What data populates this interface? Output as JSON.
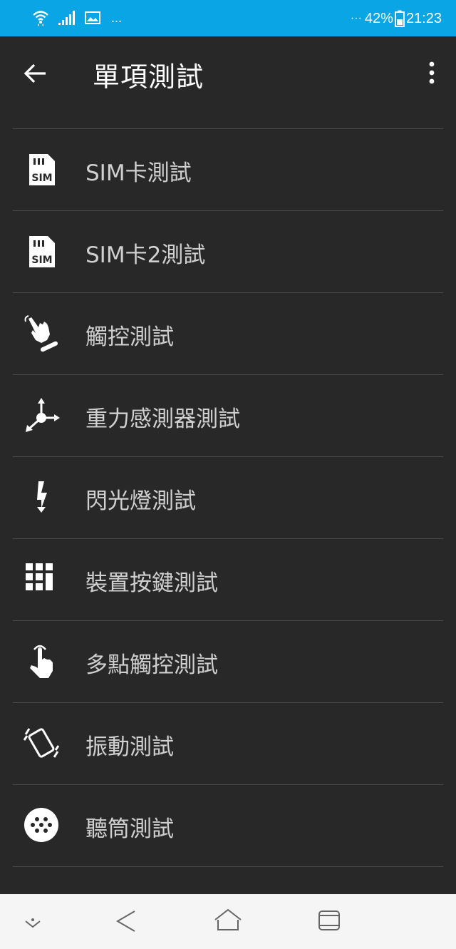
{
  "status_bar": {
    "battery_percent": "42%",
    "time": "21:23",
    "more_dots": "...",
    "notif_dots": "···",
    "icons": [
      "wifi-icon",
      "signal-icon",
      "image-icon",
      "battery-icon"
    ]
  },
  "app_bar": {
    "title": "單項測試",
    "icons": [
      "back-arrow-icon",
      "overflow-menu-icon"
    ]
  },
  "items": [
    {
      "label": "SIM卡測試",
      "icon": "sim-card-icon"
    },
    {
      "label": "SIM卡2測試",
      "icon": "sim-card-icon"
    },
    {
      "label": "觸控測試",
      "icon": "touch-hand-icon"
    },
    {
      "label": "重力感測器測試",
      "icon": "axis-icon"
    },
    {
      "label": "閃光燈測試",
      "icon": "flash-icon"
    },
    {
      "label": "裝置按鍵測試",
      "icon": "keypad-icon"
    },
    {
      "label": "多點觸控測試",
      "icon": "multi-touch-icon"
    },
    {
      "label": "振動測試",
      "icon": "vibration-icon"
    },
    {
      "label": "聽筒測試",
      "icon": "earpiece-icon"
    }
  ],
  "nav_bar": {
    "icons": [
      "nav-down-icon",
      "nav-back-icon",
      "nav-home-icon",
      "nav-recents-icon"
    ]
  },
  "colors": {
    "status_bar": "#0aa5e4",
    "background": "#282828",
    "divider": "#4a4a4a",
    "label_text": "#d0d0d0",
    "nav_bar": "#f5f5f5"
  }
}
